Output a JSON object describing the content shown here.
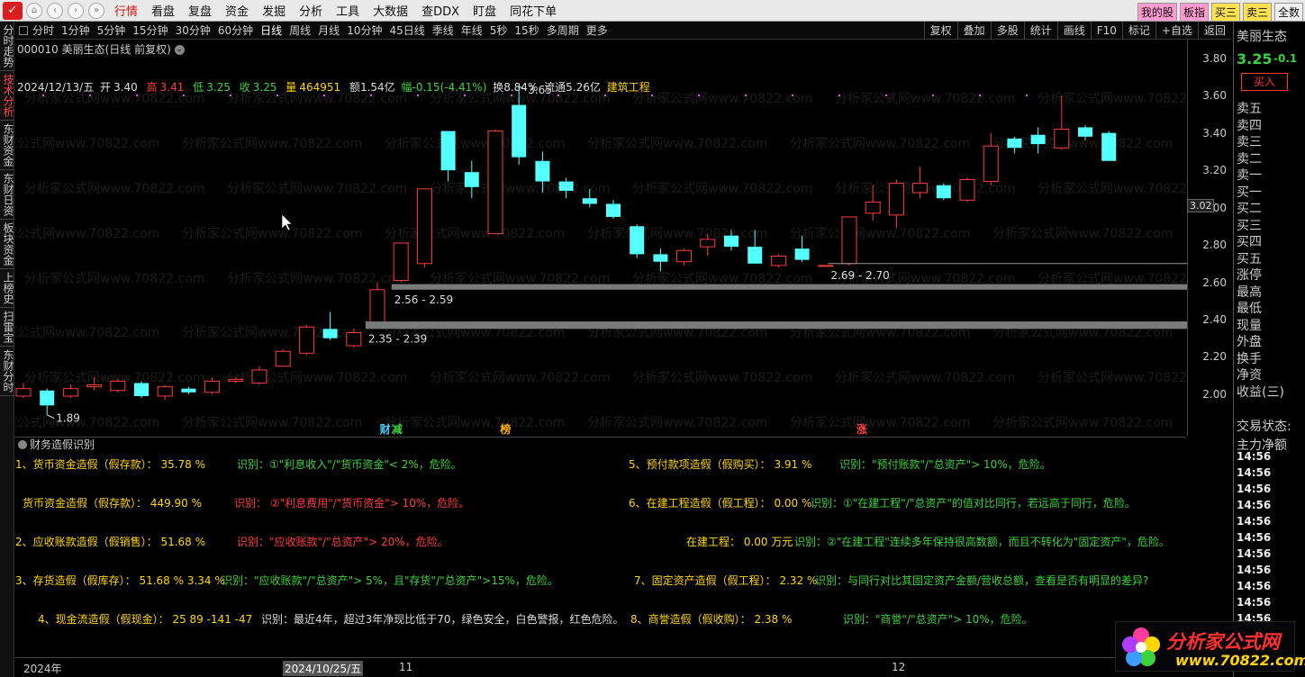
{
  "menu": [
    "行情",
    "看盘",
    "复盘",
    "资金",
    "发掘",
    "分析",
    "工具",
    "大数据",
    "查DDX",
    "盯盘",
    "同花下单"
  ],
  "menu_active": 0,
  "top_right": [
    "我的股",
    "板指",
    "买三",
    "卖三",
    "全数"
  ],
  "left_tabs": [
    "分时走势",
    "技术分析",
    "东财资金",
    "东财日资",
    "板块资金",
    "上榜史",
    "扫雷宝",
    "东财分时"
  ],
  "left_active": 1,
  "periods": [
    "分时",
    "1分钟",
    "5分钟",
    "15分钟",
    "30分钟",
    "60分钟",
    "日线",
    "周线",
    "月线",
    "10分钟",
    "45日线",
    "季线",
    "年线",
    "5秒",
    "15秒",
    "多周期",
    "更多"
  ],
  "period_active": 6,
  "tools": [
    "复权",
    "叠加",
    "多股",
    "统计",
    "画线",
    "F10",
    "标记",
    "+自选",
    "返回"
  ],
  "chart_title": "000010 美丽生态(日线 前复权)",
  "info": {
    "date": "2024/12/13/五",
    "open_label": "开",
    "open": "3.40",
    "high_label": "高",
    "high": "3.41",
    "low_label": "低",
    "low": "3.25",
    "close_label": "收",
    "close": "3.25",
    "vol_label": "量",
    "vol": "464951",
    "amount": "额1.54亿",
    "change": "幅-0.15(-4.41%)",
    "turnover": "换8.84%",
    "float": "流通5.26亿",
    "sector": "建筑工程"
  },
  "chart_data": {
    "type": "candlestick",
    "ylim": [
      1.85,
      3.9
    ],
    "yticks": [
      "3.80",
      "3.60",
      "3.40",
      "3.20",
      "3.00",
      "2.80",
      "2.60",
      "2.40",
      "2.20",
      "2.00"
    ],
    "candles": [
      [
        1.99,
        2.03,
        1.98,
        2.06
      ],
      [
        2.02,
        1.94,
        1.89,
        2.03
      ],
      [
        1.99,
        2.03,
        1.98,
        2.05
      ],
      [
        2.04,
        2.05,
        2.02,
        2.09
      ],
      [
        2.02,
        2.07,
        2.01,
        2.08
      ],
      [
        2.06,
        1.99,
        1.98,
        2.07
      ],
      [
        1.99,
        2.04,
        1.97,
        2.05
      ],
      [
        2.03,
        2.01,
        2.0,
        2.04
      ],
      [
        2.01,
        2.07,
        2.0,
        2.09
      ],
      [
        2.07,
        2.08,
        2.06,
        2.09
      ],
      [
        2.06,
        2.13,
        2.05,
        2.15
      ],
      [
        2.15,
        2.23,
        2.15,
        2.24
      ],
      [
        2.22,
        2.36,
        2.21,
        2.37
      ],
      [
        2.35,
        2.3,
        2.29,
        2.44
      ],
      [
        2.26,
        2.33,
        2.25,
        2.35
      ],
      [
        2.38,
        2.56,
        2.37,
        2.6
      ],
      [
        2.61,
        2.81,
        2.6,
        2.81
      ],
      [
        2.7,
        3.1,
        2.68,
        3.1
      ],
      [
        3.41,
        3.2,
        3.14,
        3.41
      ],
      [
        3.19,
        3.11,
        3.05,
        3.25
      ],
      [
        2.86,
        3.41,
        2.86,
        3.42
      ],
      [
        3.55,
        3.27,
        3.23,
        3.65
      ],
      [
        3.25,
        3.14,
        3.08,
        3.3
      ],
      [
        3.14,
        3.09,
        3.05,
        3.16
      ],
      [
        3.05,
        3.02,
        3.0,
        3.1
      ],
      [
        3.02,
        2.95,
        2.94,
        3.04
      ],
      [
        2.9,
        2.75,
        2.73,
        2.91
      ],
      [
        2.75,
        2.71,
        2.66,
        2.78
      ],
      [
        2.71,
        2.77,
        2.69,
        2.78
      ],
      [
        2.79,
        2.83,
        2.74,
        2.86
      ],
      [
        2.85,
        2.79,
        2.77,
        2.88
      ],
      [
        2.79,
        2.7,
        2.7,
        2.88
      ],
      [
        2.69,
        2.74,
        2.68,
        2.75
      ],
      [
        2.78,
        2.72,
        2.71,
        2.85
      ],
      [
        2.69,
        2.69,
        2.69,
        2.69
      ],
      [
        2.7,
        2.95,
        2.69,
        2.95
      ],
      [
        2.97,
        3.03,
        2.93,
        3.12
      ],
      [
        2.96,
        3.13,
        2.89,
        3.15
      ],
      [
        3.08,
        3.13,
        3.05,
        3.22
      ],
      [
        3.12,
        3.05,
        3.04,
        3.13
      ],
      [
        3.04,
        3.15,
        3.03,
        3.16
      ],
      [
        3.14,
        3.33,
        3.12,
        3.4
      ],
      [
        3.37,
        3.32,
        3.29,
        3.38
      ],
      [
        3.39,
        3.34,
        3.29,
        3.43
      ],
      [
        3.32,
        3.42,
        3.31,
        3.6
      ],
      [
        3.43,
        3.38,
        3.36,
        3.44
      ],
      [
        3.4,
        3.25,
        3.25,
        3.41
      ]
    ],
    "gaps": [
      {
        "low": 2.35,
        "high": 2.39,
        "label": "2.35 - 2.39"
      },
      {
        "low": 2.56,
        "high": 2.59,
        "label": "2.56 - 2.59"
      },
      {
        "low": 2.69,
        "high": 2.7,
        "label": "2.69 - 2.70"
      }
    ],
    "annotations": [
      {
        "label": "3.65",
        "price": 3.65
      },
      {
        "label": "1.89",
        "price": 1.89
      }
    ],
    "markers": [
      {
        "label": "财",
        "color": "#3cd2ff"
      },
      {
        "label": "减",
        "color": "#3cd23c"
      },
      {
        "label": "榜",
        "color": "#ffb000"
      },
      {
        "label": "涨",
        "color": "#ff4040"
      }
    ],
    "current_price": "3.02"
  },
  "panel": {
    "title": "财务造假识别",
    "r1l_a": "1、货币资金造假（假存款）： 35.78 %",
    "r1l_b": "识别：①\"利息收入\"/\"货币资金\"< 2%，危险。",
    "r1r_a": "5、预付款项造假（假购买）： 3.91 %",
    "r1r_b": "识别：\"预付账款\"/\"总资产\"> 10%，危险。",
    "r2l_a": "货币资金造假（假存款）： 449.90 %",
    "r2l_b": "识别： ②\"利息费用\"/\"货币资金\"> 10%，危险。",
    "r2r_a": "6、在建工程造假（假工程）： 0.00 %",
    "r2r_b": "识别：①\"在建工程\"/\"总资产\"的值对比同行，若远高于同行，危险。",
    "r3l_a": "2、应收账款造假（假销售）： 51.68 %",
    "r3l_b": "识别：\"应收账款\"/\"总资产\"> 20%，危险。",
    "r3r_a": "在建工程： 0.00 万元",
    "r3r_b": "识别：②\"在建工程\"连续多年保持很高数额，而且不转化为\"固定资产\"，危险。",
    "r4l_a": "3、存货造假（假库存）： 51.68 % 3.34 %",
    "r4l_b": "识别：\"应收账款\"/\"总资产\"> 5%，且\"存货\"/\"总资产\">15%，危险。",
    "r4r_a": "7、固定资产造假（假工程）： 2.32 %",
    "r4r_b": "识别：与同行对比其固定资产金额/营收总额，查看是否有明显的差异?",
    "r5l_a": "4、现金流造假（假现金）： 25 89 -141 -47",
    "r5l_b": "识别：最近4年，超过3年净现比低于70，绿色安全，白色警报，红色危险。",
    "r5r_a": "8、商誉造假（假收购）： 2.38 %",
    "r5r_b": "识别：\"商誉\"/\"总资产\"> 10%，危险。"
  },
  "dates": [
    "2024年",
    "2024/10/25/五",
    "11",
    "12"
  ],
  "quote": {
    "name": "美丽生态",
    "price": "3.25",
    "change": "-0.1",
    "buy": "买入",
    "labels": [
      "卖五",
      "卖四",
      "卖三",
      "卖二",
      "卖一",
      "买一",
      "买二",
      "买三",
      "买四",
      "买五",
      "涨停",
      "最高",
      "最低",
      "现量",
      "外盘",
      "换手",
      "净资",
      "收益(三)",
      "交易状态:",
      "主力净额"
    ],
    "times": [
      "14:56",
      "14:56",
      "14:56",
      "14:56",
      "14:56",
      "14:56",
      "14:56",
      "14:56",
      "14:56",
      "14:56",
      "14:56"
    ]
  },
  "watermark": {
    "title": "分析家公式网",
    "url": "www.70822.com"
  },
  "watermark_text": "分析家公式网www.70822.com",
  "colors": {
    "up": "#ff3c3c",
    "down": "#54ffff",
    "bg": "#000000"
  }
}
